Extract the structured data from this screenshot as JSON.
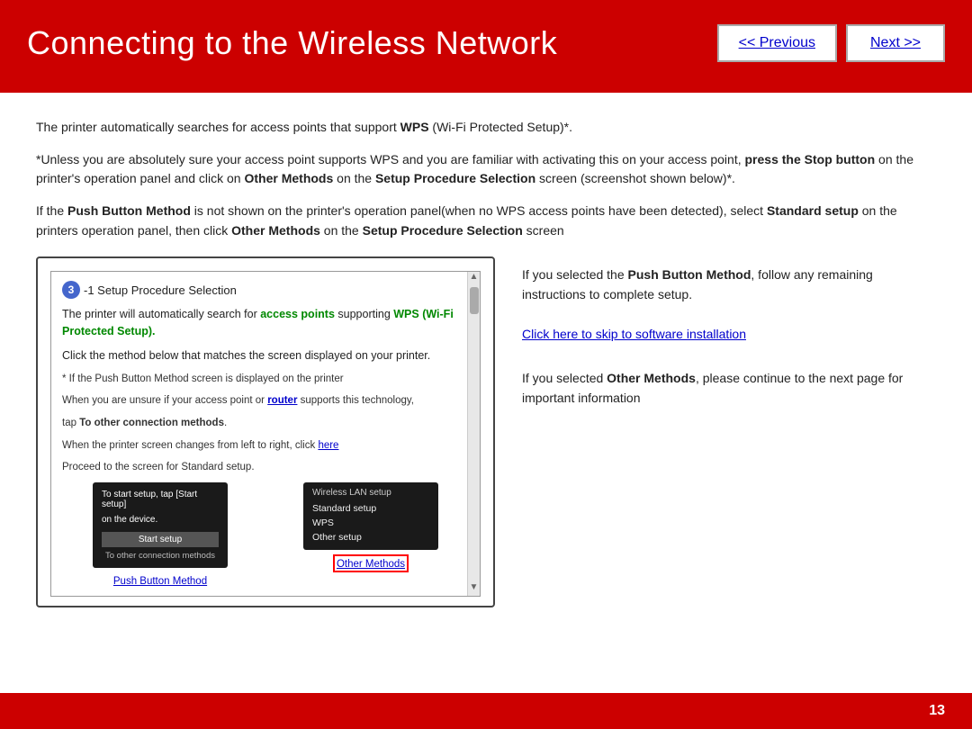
{
  "header": {
    "title": "Connecting to the Wireless Network",
    "prev_label": "<< Previous",
    "next_label": "Next >>"
  },
  "content": {
    "para1": "The  printer automatically searches for access points that support ",
    "para1_bold": "WPS",
    "para1_rest": " (Wi-Fi Protected Setup)*.",
    "para2_prefix": "*Unless you are absolutely sure your access point supports WPS and you are familiar with activating  this on your access point, ",
    "para2_bold1": "press the Stop button",
    "para2_mid": " on the printer's operation panel and click on  ",
    "para2_bold2": "Other Methods",
    "para2_mid2": " on the ",
    "para2_bold3": "Setup Procedure Selection",
    "para2_end": " screen (screenshot shown below)*.",
    "para3_prefix": "If the ",
    "para3_bold1": "Push Button Method",
    "para3_mid": " is not shown  on the printer's operation panel(when no WPS access points have been detected), select ",
    "para3_bold2": "Standard setup",
    "para3_mid2": " on the printers operation panel, then click ",
    "para3_bold3": "Other Methods",
    "para3_mid3": " on the ",
    "para3_bold4": "Setup Procedure Selection",
    "para3_end": " screen"
  },
  "screenshot": {
    "step_label": "-1 Setup Procedure Selection",
    "step_number": "3",
    "intro_text": "The printer will automatically search for ",
    "intro_green": "access points",
    "intro_mid": " supporting ",
    "intro_orange": "WPS (Wi-Fi Protected Setup).",
    "click_text": "Click the method below that matches the screen displayed on your printer.",
    "note1": "* If the Push Button Method screen is displayed on the printer",
    "note2": "When you are unsure if your access point or ",
    "note2_link": "router",
    "note2_end": " supports this technology,",
    "note3": "tap ",
    "note3_bold": "To other connection methods",
    "note3_end": ".",
    "note4_prefix": "When the printer screen changes from left to right, click ",
    "note4_link": "here",
    "note5": "Proceed to the screen for Standard setup.",
    "left_screen": {
      "line1": "To start setup, tap [Start setup]",
      "line2": "on the device.",
      "btn1": "Start setup",
      "btn2": "To other connection methods"
    },
    "right_screen": {
      "title": "Wireless LAN setup",
      "item1": "Standard setup",
      "item2": "WPS",
      "item3": "Other setup"
    },
    "left_link": "Push Button Method",
    "right_link": "Other Methods"
  },
  "right_panel": {
    "section1_prefix": "If you selected the ",
    "section1_bold": "Push Button Method",
    "section1_end": ", follow any remaining instructions to complete setup.",
    "skip_link": "Click here to skip to software installation",
    "section2_prefix": "If you selected ",
    "section2_bold": "Other Methods",
    "section2_end": ", please continue to the next page  for important information"
  },
  "footer": {
    "page_number": "13"
  }
}
